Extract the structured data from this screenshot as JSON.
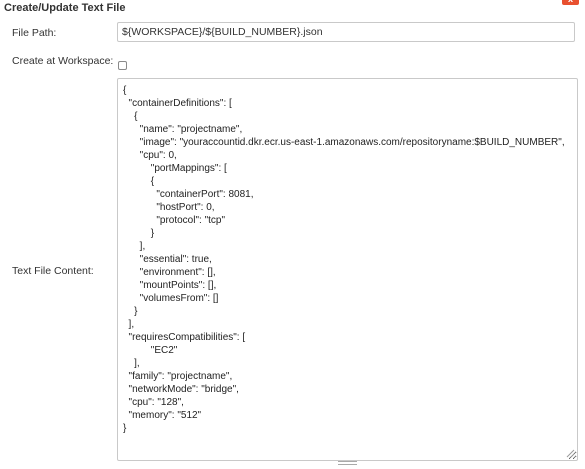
{
  "form": {
    "title": "Create/Update Text File",
    "close_label": "x",
    "file_path": {
      "label": "File Path:",
      "value": "${WORKSPACE}/${BUILD_NUMBER}.json"
    },
    "create_at_workspace": {
      "label": "Create at Workspace:",
      "checked": false
    },
    "text_file_content": {
      "label": "Text File Content:",
      "value": "{\n  \"containerDefinitions\": [\n    {\n      \"name\": \"projectname\",\n      \"image\": \"youraccountid.dkr.ecr.us-east-1.amazonaws.com/repositoryname:$BUILD_NUMBER\",\n      \"cpu\": 0,\n          \"portMappings\": [\n          {\n            \"containerPort\": 8081,\n            \"hostPort\": 0,\n            \"protocol\": \"tcp\"\n          }\n      ],\n      \"essential\": true,\n      \"environment\": [],\n      \"mountPoints\": [],\n      \"volumesFrom\": []\n    }\n  ],\n  \"requiresCompatibilities\": [\n          \"EC2\"\n    ],\n  \"family\": \"projectname\",\n  \"networkMode\": \"bridge\",\n  \"cpu\": \"128\",\n  \"memory\": \"512\"\n}"
    }
  },
  "icons": {
    "close": "close-icon",
    "resize": "resize-grip-icon",
    "drag": "drag-handle-icon"
  },
  "colors": {
    "close_button": "#e8502f",
    "border": "#c9c9c9",
    "text": "#333333"
  }
}
